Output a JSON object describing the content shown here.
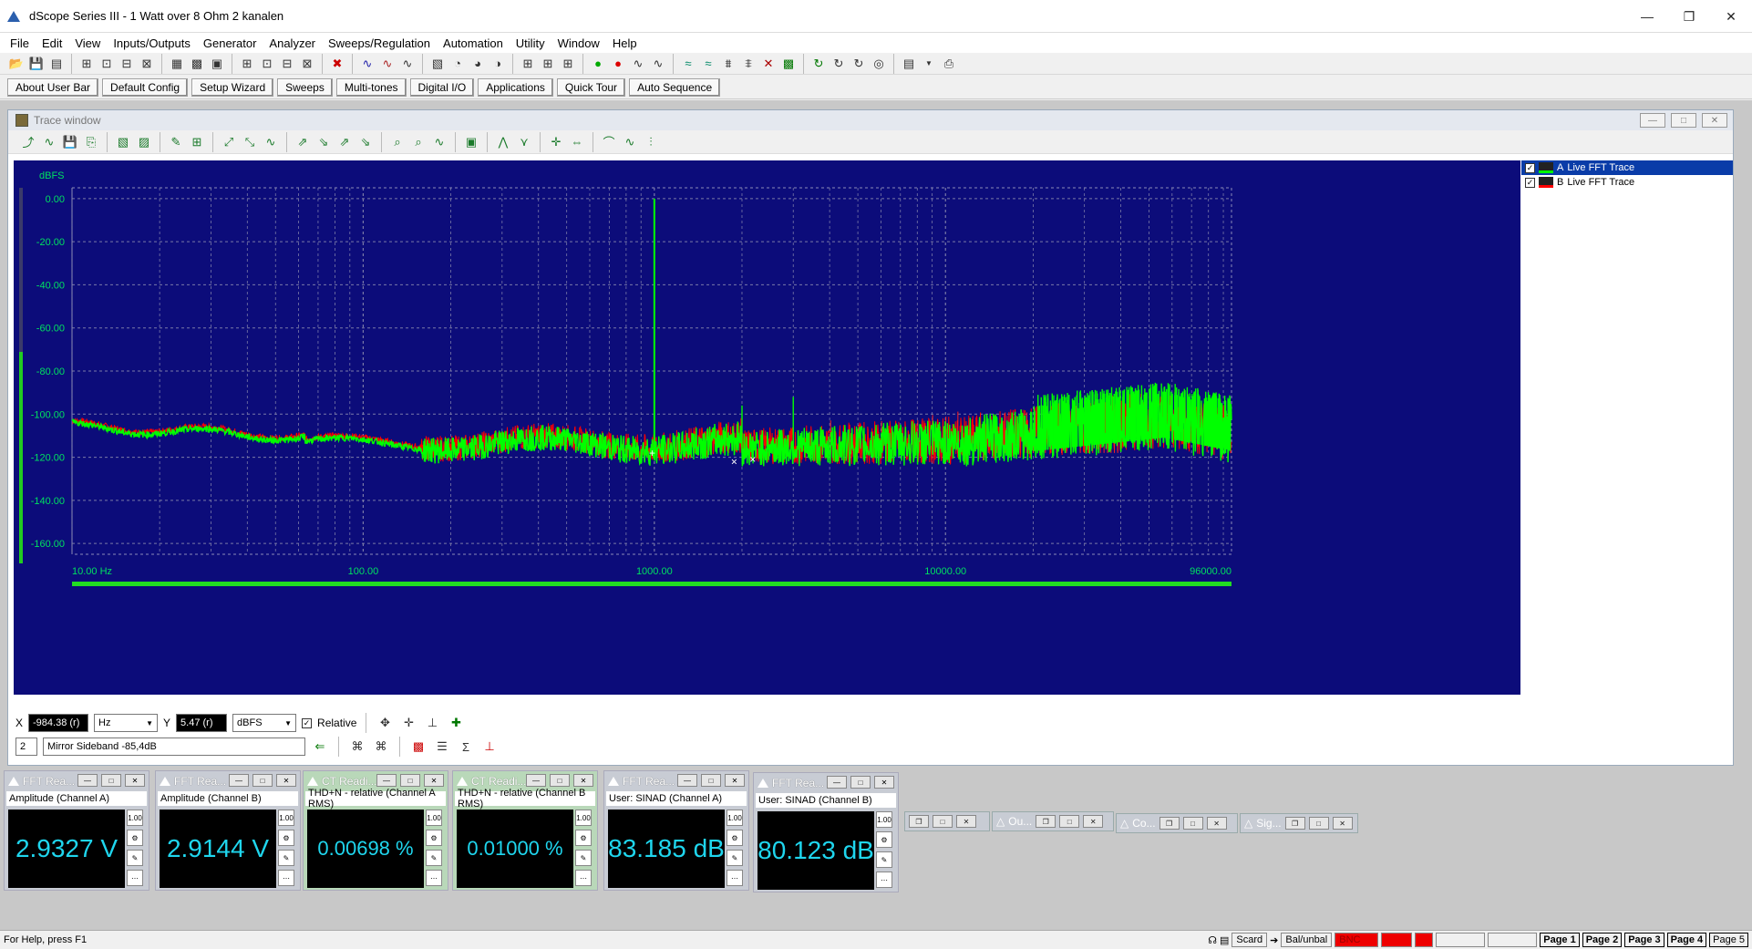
{
  "window": {
    "title": "dScope Series III - 1 Watt over 8 Ohm 2 kanalen"
  },
  "menu": [
    "File",
    "Edit",
    "View",
    "Inputs/Outputs",
    "Generator",
    "Analyzer",
    "Sweeps/Regulation",
    "Automation",
    "Utility",
    "Window",
    "Help"
  ],
  "user_bar": [
    "About User Bar",
    "Default Config",
    "Setup Wizard",
    "Sweeps",
    "Multi-tones",
    "Digital I/O",
    "Applications",
    "Quick Tour",
    "Auto Sequence"
  ],
  "trace_window": {
    "title": "Trace window",
    "legend": [
      {
        "check": "✓",
        "channel": "A",
        "label": "Live FFT Trace",
        "color": "#00ff00"
      },
      {
        "check": "✓",
        "channel": "B",
        "label": "Live FFT Trace",
        "color": "#ff0000"
      }
    ]
  },
  "chart_data": {
    "type": "line",
    "ylabel": "dBFS",
    "ylim": [
      -165,
      5
    ],
    "yticks": [
      "0.00",
      "-20.00",
      "-40.00",
      "-60.00",
      "-80.00",
      "-100.00",
      "-120.00",
      "-140.00",
      "-160.00"
    ],
    "xscale": "log",
    "xlim": [
      10,
      96000
    ],
    "xticks": [
      "10.00 Hz",
      "100.00",
      "1000.00",
      "10000.00",
      "96000.00"
    ],
    "grid": true,
    "series": [
      {
        "color": "#00ff00",
        "peaks": [
          {
            "x": 1000,
            "y": 0
          },
          {
            "x": 2000,
            "y": -96
          },
          {
            "x": 3000,
            "y": -92
          }
        ]
      },
      {
        "color": "#ff0000"
      }
    ],
    "noise_floor_db": -118,
    "hf_rise_peak_db": -100
  },
  "cursor": {
    "x_label": "X",
    "x_value": "-984.38 (r)",
    "x_unit": "Hz",
    "y_label": "Y",
    "y_value": "5.47 (r)",
    "y_unit": "dBFS",
    "relative_label": "Relative",
    "relative_checked": "✓"
  },
  "annotation": {
    "index": "2",
    "text": "Mirror Sideband -85,4dB"
  },
  "readings": [
    {
      "title": "FFT Rea...",
      "label": "Amplitude (Channel A)",
      "value": "2.9327 V"
    },
    {
      "title": "FFT Rea...",
      "label": "Amplitude (Channel B)",
      "value": "2.9144 V"
    },
    {
      "title": "CT Readi...",
      "label": "THD+N - relative (Channel A RMS)",
      "value": "0.00698 %"
    },
    {
      "title": "CT Readi...",
      "label": "THD+N - relative (Channel B RMS)",
      "value": "0.01000 %"
    },
    {
      "title": "FFT Rea...",
      "label": "User: SINAD (Channel A)",
      "value": "83.185 dB"
    },
    {
      "title": "FFT Rea...",
      "label": "User: SINAD (Channel B)",
      "value": "80.123 dB"
    }
  ],
  "minimized": [
    "Ou...",
    "Co...",
    "Sig..."
  ],
  "status": {
    "help": "For Help, press F1",
    "card": "Scard",
    "bal": "Bal/unbal",
    "bnc": "BNC",
    "pages": [
      "Page 1",
      "Page 2",
      "Page 3",
      "Page 4",
      "Page 5"
    ]
  }
}
